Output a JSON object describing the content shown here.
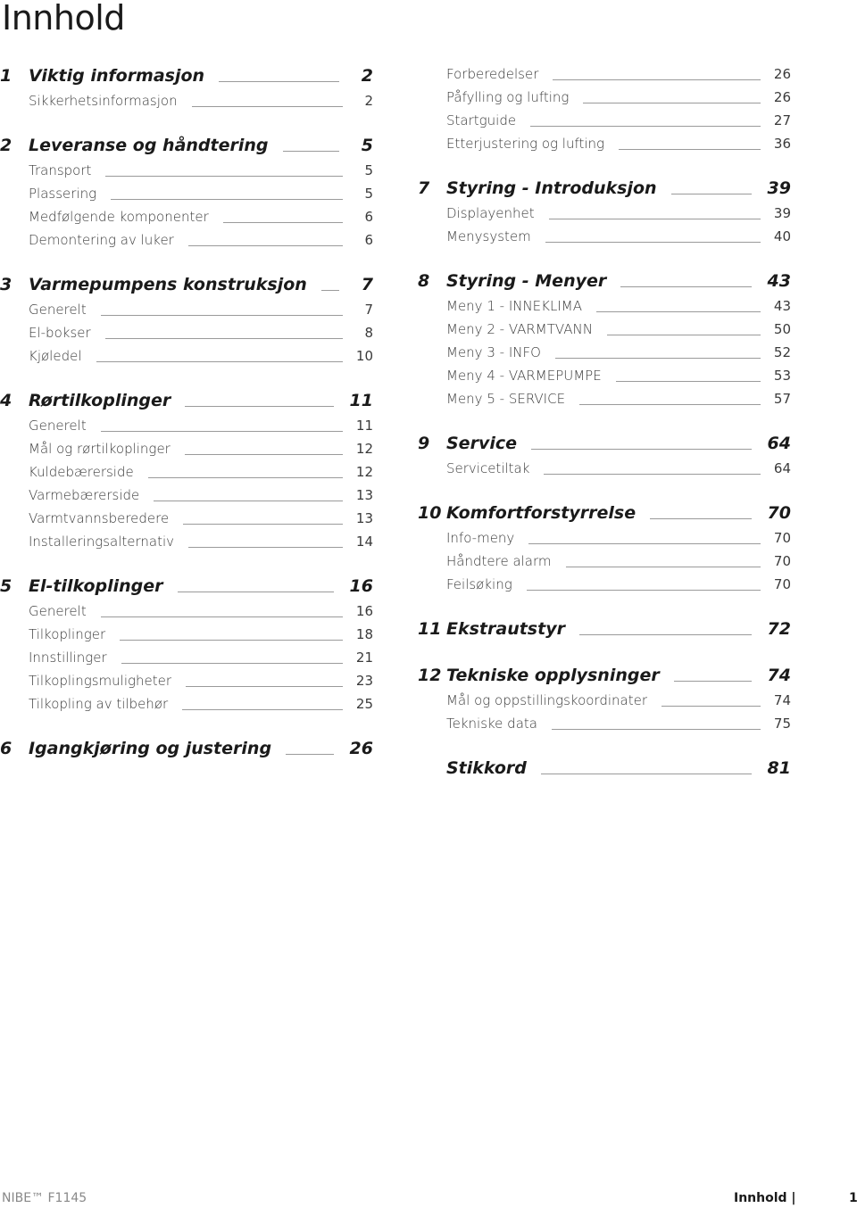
{
  "title": "Innhold",
  "left_column": [
    {
      "num": "1",
      "title": "Viktig informasjon",
      "page": "2",
      "items": [
        {
          "title": "Sikkerhetsinformasjon",
          "page": "2"
        }
      ]
    },
    {
      "num": "2",
      "title": "Leveranse og håndtering",
      "page": "5",
      "items": [
        {
          "title": "Transport",
          "page": "5"
        },
        {
          "title": "Plassering",
          "page": "5"
        },
        {
          "title": "Medfølgende komponenter",
          "page": "6"
        },
        {
          "title": "Demontering av luker",
          "page": "6"
        }
      ]
    },
    {
      "num": "3",
      "title": "Varmepumpens konstruksjon",
      "page": "7",
      "items": [
        {
          "title": "Generelt",
          "page": "7"
        },
        {
          "title": "El-bokser",
          "page": "8"
        },
        {
          "title": "Kjøledel",
          "page": "10"
        }
      ]
    },
    {
      "num": "4",
      "title": "Rørtilkoplinger",
      "page": "11",
      "items": [
        {
          "title": "Generelt",
          "page": "11"
        },
        {
          "title": "Mål og rørtilkoplinger",
          "page": "12"
        },
        {
          "title": "Kuldebærerside",
          "page": "12"
        },
        {
          "title": "Varmebærerside",
          "page": "13"
        },
        {
          "title": "Varmtvannsberedere",
          "page": "13"
        },
        {
          "title": "Installeringsalternativ",
          "page": "14"
        }
      ]
    },
    {
      "num": "5",
      "title": "El-tilkoplinger",
      "page": "16",
      "items": [
        {
          "title": "Generelt",
          "page": "16"
        },
        {
          "title": "Tilkoplinger",
          "page": "18"
        },
        {
          "title": "Innstillinger",
          "page": "21"
        },
        {
          "title": "Tilkoplingsmuligheter",
          "page": "23"
        },
        {
          "title": "Tilkopling av tilbehør",
          "page": "25"
        }
      ]
    },
    {
      "num": "6",
      "title": "Igangkjøring og justering",
      "page": "26",
      "items": []
    }
  ],
  "right_column": [
    {
      "num": null,
      "title": null,
      "page": null,
      "items": [
        {
          "title": "Forberedelser",
          "page": "26"
        },
        {
          "title": "Påfylling og lufting",
          "page": "26"
        },
        {
          "title": "Startguide",
          "page": "27"
        },
        {
          "title": "Etterjustering og lufting",
          "page": "36"
        }
      ]
    },
    {
      "num": "7",
      "title": "Styring - Introduksjon",
      "page": "39",
      "items": [
        {
          "title": "Displayenhet",
          "page": "39"
        },
        {
          "title": "Menysystem",
          "page": "40"
        }
      ]
    },
    {
      "num": "8",
      "title": "Styring - Menyer",
      "page": "43",
      "items": [
        {
          "title": "Meny 1 - INNEKLIMA",
          "page": "43"
        },
        {
          "title": "Meny 2 - VARMTVANN",
          "page": "50"
        },
        {
          "title": "Meny 3 - INFO",
          "page": "52"
        },
        {
          "title": "Meny 4 - VARMEPUMPE",
          "page": "53"
        },
        {
          "title": "Meny 5 - SERVICE",
          "page": "57"
        }
      ]
    },
    {
      "num": "9",
      "title": "Service",
      "page": "64",
      "items": [
        {
          "title": "Servicetiltak",
          "page": "64"
        }
      ]
    },
    {
      "num": "10",
      "title": "Komfortforstyrrelse",
      "page": "70",
      "items": [
        {
          "title": "Info-meny",
          "page": "70"
        },
        {
          "title": "Håndtere alarm",
          "page": "70"
        },
        {
          "title": "Feilsøking",
          "page": "70"
        }
      ]
    },
    {
      "num": "11",
      "title": "Ekstrautstyr",
      "page": "72",
      "items": []
    },
    {
      "num": "12",
      "title": "Tekniske opplysninger",
      "page": "74",
      "items": [
        {
          "title": "Mål og oppstillingskoordinater",
          "page": "74"
        },
        {
          "title": "Tekniske data",
          "page": "75"
        }
      ]
    },
    {
      "num": "",
      "title": "Stikkord",
      "page": "81",
      "items": []
    }
  ],
  "footer": {
    "product": "NIBE™ F1145",
    "section": "Innhold |",
    "page": "1"
  }
}
